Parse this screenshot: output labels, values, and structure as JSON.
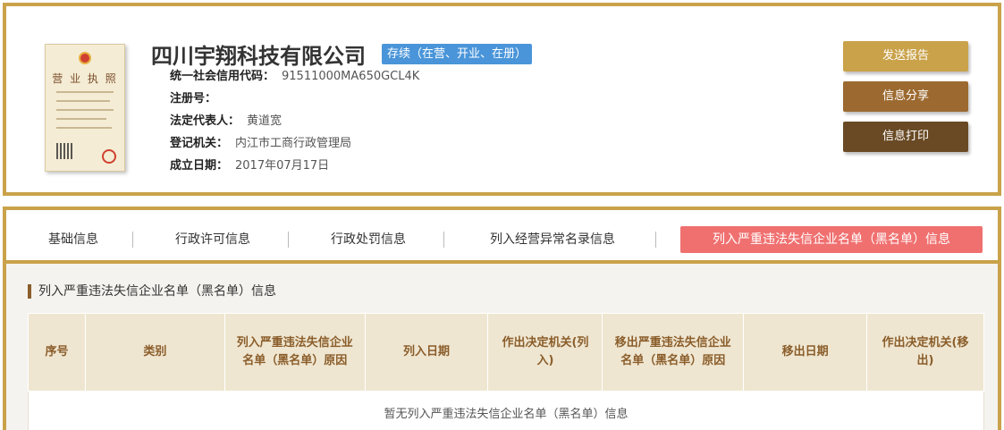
{
  "company": {
    "name": "四川宇翔科技有限公司",
    "status": "存续（在营、开业、在册）"
  },
  "license": {
    "title": "营 业 执 照"
  },
  "info": [
    {
      "label": "统一社会信用代码：",
      "value": "91511000MA650GCL4K"
    },
    {
      "label": "注册号：",
      "value": ""
    },
    {
      "label": "法定代表人：",
      "value": "黄道宽"
    },
    {
      "label": "登记机关：",
      "value": "内江市工商行政管理局"
    },
    {
      "label": "成立日期：",
      "value": "2017年07月17日"
    }
  ],
  "buttons": {
    "send_report": "发送报告",
    "share": "信息分享",
    "print": "信息打印"
  },
  "colors": {
    "border": "#c9a24a",
    "btn_send": "#c9a24a",
    "btn_share": "#9c6a30",
    "btn_print": "#6a4a24",
    "active_tab": "#f07070",
    "status_badge": "#4a95d9"
  },
  "tabs": [
    {
      "label": "基础信息"
    },
    {
      "label": "行政许可信息"
    },
    {
      "label": "行政处罚信息"
    },
    {
      "label": "列入经营异常名录信息"
    },
    {
      "label": "列入严重违法失信企业名单（黑名单）信息"
    }
  ],
  "section": {
    "title": "列入严重违法失信企业名单（黑名单）信息",
    "columns": [
      "序号",
      "类别",
      "列入严重违法失信企业名单（黑名单）原因",
      "列入日期",
      "作出决定机关(列入)",
      "移出严重违法失信企业名单（黑名单）原因",
      "移出日期",
      "作出决定机关(移出)"
    ],
    "empty_message": "暂无列入严重违法失信企业名单（黑名单）信息"
  }
}
